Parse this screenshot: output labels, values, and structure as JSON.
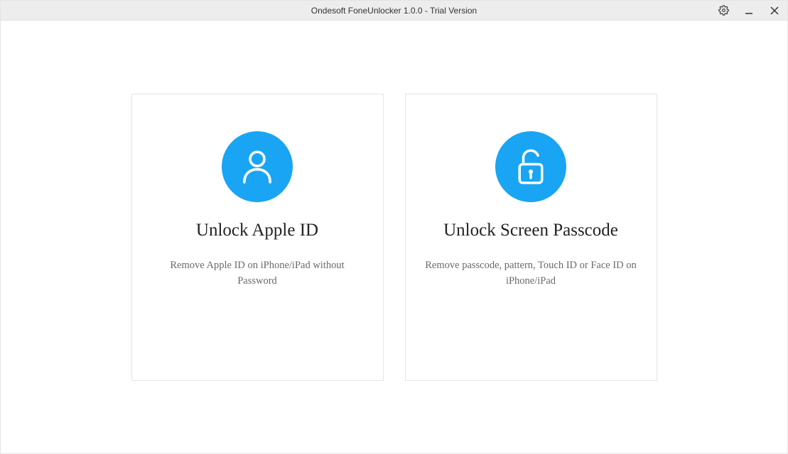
{
  "window": {
    "title": "Ondesoft FoneUnlocker 1.0.0 - Trial Version"
  },
  "cards": {
    "apple_id": {
      "title": "Unlock Apple ID",
      "desc": "Remove Apple ID on iPhone/iPad without Password"
    },
    "screen_passcode": {
      "title": "Unlock Screen Passcode",
      "desc": "Remove passcode, pattern, Touch ID or Face ID on iPhone/iPad"
    }
  }
}
